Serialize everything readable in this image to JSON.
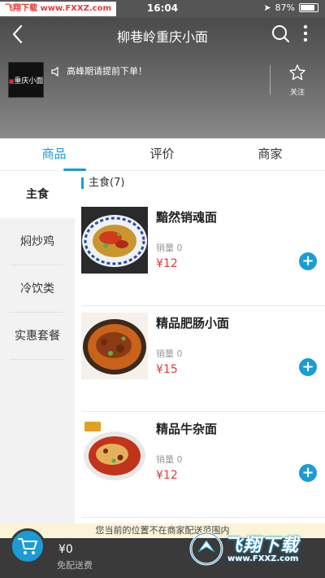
{
  "status_bar": {
    "watermark": "飞翔下载 www.FXXZ.com",
    "time": "16:04",
    "battery": "87%",
    "battery_level": 0.87
  },
  "header": {
    "title": "柳巷岭重庆小面",
    "notice": "高峰期请提前下单！",
    "follow_label": "关注",
    "logo_text": "重庆小面"
  },
  "tabs": [
    {
      "label": "商品",
      "active": true
    },
    {
      "label": "评价",
      "active": false
    },
    {
      "label": "商家",
      "active": false
    }
  ],
  "sidebar": {
    "items": [
      {
        "label": "主食",
        "active": true
      },
      {
        "label": "焖炒鸡",
        "active": false
      },
      {
        "label": "冷饮类",
        "active": false
      },
      {
        "label": "实惠套餐",
        "active": false
      }
    ]
  },
  "menu": {
    "section_title": "主食(7)",
    "items": [
      {
        "name": "黯然销魂面",
        "sales": "销量 0",
        "price": "¥12",
        "add": "+"
      },
      {
        "name": "精品肥肠小面",
        "sales": "销量 0",
        "price": "¥15",
        "add": "+"
      },
      {
        "name": "精品牛杂面",
        "sales": "销量 0",
        "price": "¥12",
        "add": "+"
      }
    ]
  },
  "footer": {
    "delivery_notice": "您当前的位置不在商家配送范围内",
    "cart_price": "¥0",
    "free_delivery": "免配送费",
    "watermark_title": "飞翔下载",
    "watermark_url": "www.FXXZ.com"
  },
  "colors": {
    "accent": "#1a9cd6",
    "price": "#e53935",
    "cart_bar": "#3a3a3a"
  }
}
